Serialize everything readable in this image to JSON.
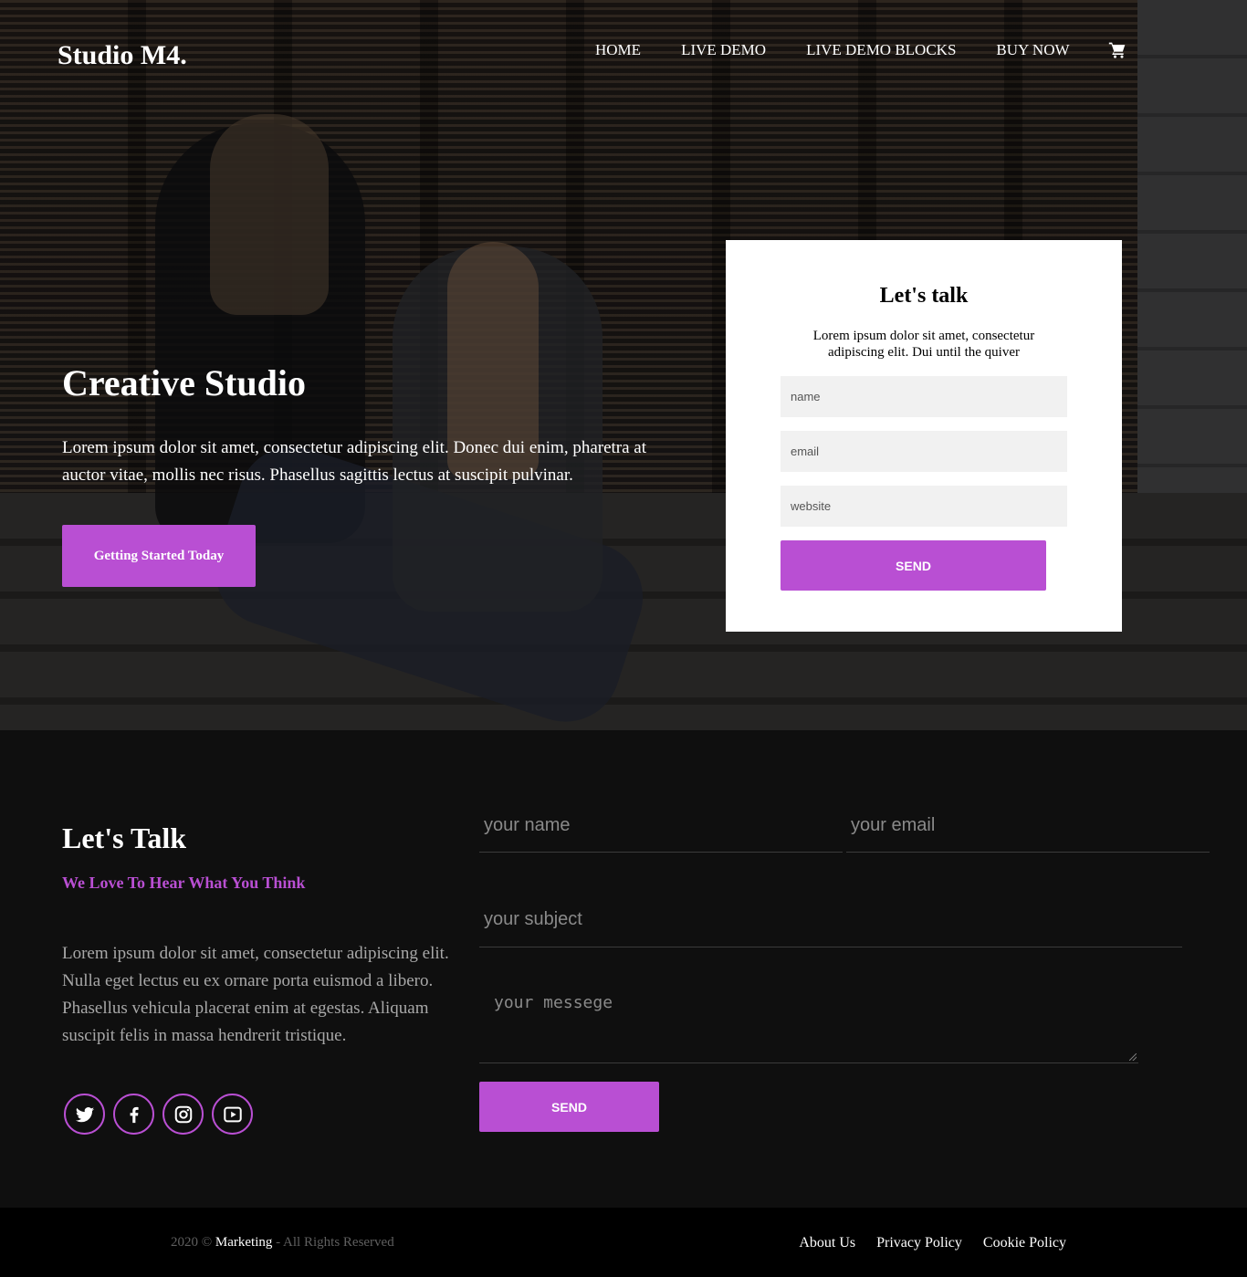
{
  "brand": {
    "logo": "Studio M4."
  },
  "nav": {
    "items": [
      {
        "label": "HOME"
      },
      {
        "label": "LIVE DEMO"
      },
      {
        "label": "LIVE DEMO BLOCKS"
      },
      {
        "label": "BUY NOW"
      }
    ],
    "cart_icon": "cart-icon"
  },
  "hero": {
    "title": "Creative Studio",
    "text": "Lorem ipsum dolor sit amet, consectetur adipiscing elit. Donec dui enim, pharetra at auctor vitae, mollis nec risus. Phasellus sagittis lectus at suscipit pulvinar.",
    "button": "Getting Started Today"
  },
  "card": {
    "title": "Let's talk",
    "text": "Lorem ipsum dolor sit amet, consectetur adipiscing elit. Dui until the quiver",
    "name_placeholder": "name",
    "email_placeholder": "email",
    "website_placeholder": "website",
    "send": "SEND"
  },
  "contact": {
    "title": "Let's Talk",
    "subtitle": "We Love To Hear What You Think",
    "text": "Lorem ipsum dolor sit amet, consectetur adipiscing elit. Nulla eget lectus eu ex ornare porta euismod a libero. Phasellus vehicula placerat enim at egestas. Aliquam suscipit felis in massa hendrerit tristique.",
    "name_placeholder": "your name",
    "email_placeholder": "your email",
    "subject_placeholder": "your subject",
    "message_placeholder": "your messege",
    "send": "SEND",
    "socials": [
      "twitter-icon",
      "facebook-icon",
      "instagram-icon",
      "youtube-icon"
    ]
  },
  "footer": {
    "copyright_prefix": "2020 © ",
    "brand": "Marketing",
    "copyright_suffix": " - All Rights Reserved",
    "links": [
      {
        "label": "About Us"
      },
      {
        "label": "Privacy Policy"
      },
      {
        "label": "Cookie Policy"
      }
    ]
  },
  "colors": {
    "accent": "#b94fd3",
    "dark": "#0f0f0f",
    "footer": "#000000"
  }
}
